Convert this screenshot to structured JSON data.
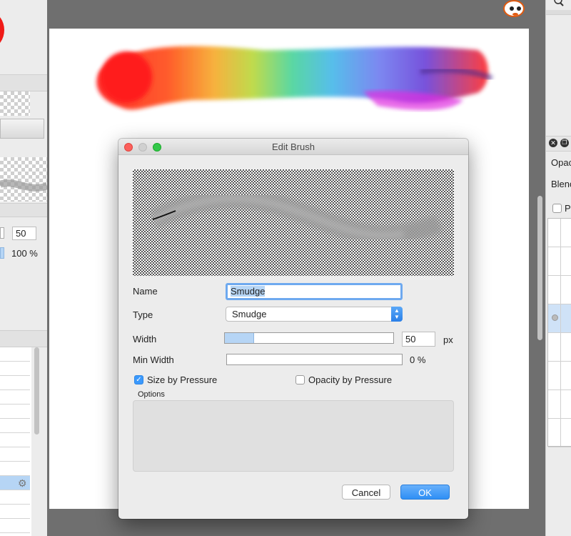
{
  "dialog": {
    "title": "Edit Brush",
    "name_label": "Name",
    "name_value": "Smudge",
    "type_label": "Type",
    "type_value": "Smudge",
    "width_label": "Width",
    "width_value": "50",
    "width_unit": "px",
    "width_fraction": 0.17,
    "min_width_label": "Min Width",
    "min_width_value": "0 %",
    "min_width_fraction": 0,
    "size_by_pressure_label": "Size by Pressure",
    "size_by_pressure_checked": true,
    "opacity_by_pressure_label": "Opacity by Pressure",
    "opacity_by_pressure_checked": false,
    "options_label": "Options",
    "cancel_label": "Cancel",
    "ok_label": "OK"
  },
  "left_panel": {
    "width_value": "50",
    "opacity_value": "100 %"
  },
  "right_panel": {
    "opacity_label": "Opac",
    "blend_label": "Blenc",
    "preserve_label": "P"
  },
  "colors": {
    "accent": "#3b99fc",
    "ok_button": "#2e8ff5",
    "selection": "#b6d5f5"
  },
  "icons": {
    "zoom": "magnifier-icon",
    "avatar": "panda-icon",
    "settings": "gear-icon"
  }
}
